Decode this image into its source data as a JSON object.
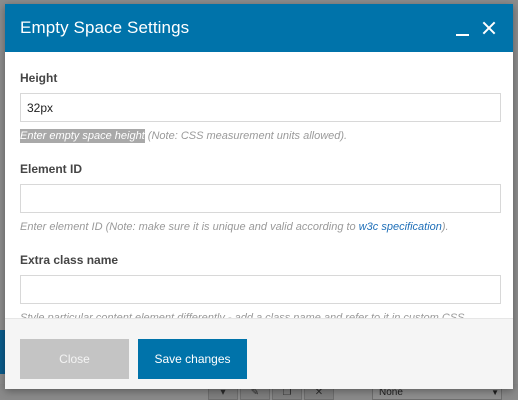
{
  "modal": {
    "title": "Empty Space Settings"
  },
  "fields": {
    "height": {
      "label": "Height",
      "value": "32px",
      "help_highlight": "Enter empty space height",
      "help_rest": " (Note: CSS measurement units allowed)."
    },
    "element_id": {
      "label": "Element ID",
      "value": "",
      "help_before": "Enter element ID (Note: make sure it is unique and valid according to ",
      "help_link": "w3c specification",
      "help_after": ")."
    },
    "extra_class": {
      "label": "Extra class name",
      "value": "",
      "help": "Style particular content element differently - add a class name and refer to it in custom CSS."
    }
  },
  "footer": {
    "close_label": "Close",
    "save_label": "Save changes"
  },
  "background": {
    "select_value": "None"
  },
  "colors": {
    "header": "#0073aa",
    "primary_button": "#0073aa",
    "link": "#1e6fb8"
  }
}
